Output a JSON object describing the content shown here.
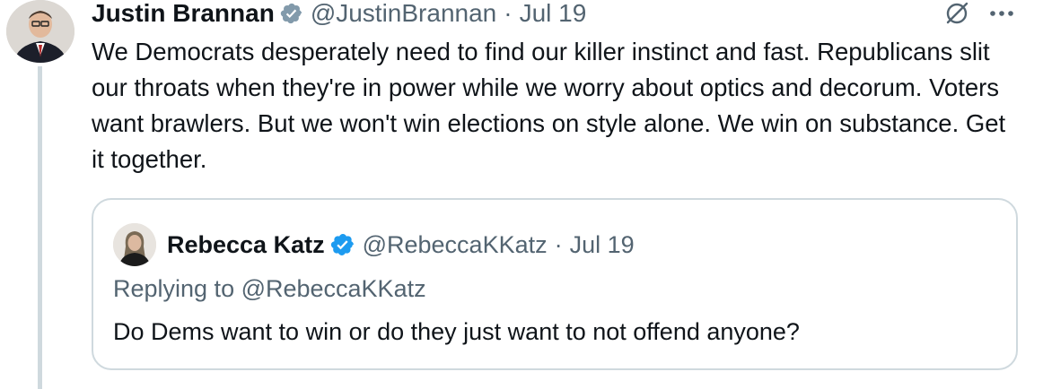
{
  "tweet": {
    "author": {
      "display_name": "Justin Brannan",
      "handle": "@JustinBrannan",
      "verified_icon": "verified-badge-gray",
      "avatar_icon": "avatar-photo"
    },
    "separator": "·",
    "date": "Jul 19",
    "text": "We Democrats desperately need to find our killer instinct and fast. Republicans slit our throats when they're in power while we worry about optics and decorum. Voters want brawlers. But we won't win elections on style alone. We win on substance. Get it together.",
    "actions": {
      "grok_icon": "grok-icon",
      "more_icon": "more-icon"
    }
  },
  "quoted_tweet": {
    "author": {
      "display_name": "Rebecca Katz",
      "handle": "@RebeccaKKatz",
      "verified_icon": "verified-badge-blue",
      "avatar_icon": "avatar-photo"
    },
    "separator": "·",
    "date": "Jul 19",
    "replying_to": "Replying to @RebeccaKKatz",
    "text": "Do Dems want to win or do they just want to not offend anyone?"
  },
  "colors": {
    "text_primary": "#0f1419",
    "text_secondary": "#536471",
    "border": "#cfd9de",
    "verified_blue": "#1d9bf0",
    "verified_gray": "#829aab"
  }
}
